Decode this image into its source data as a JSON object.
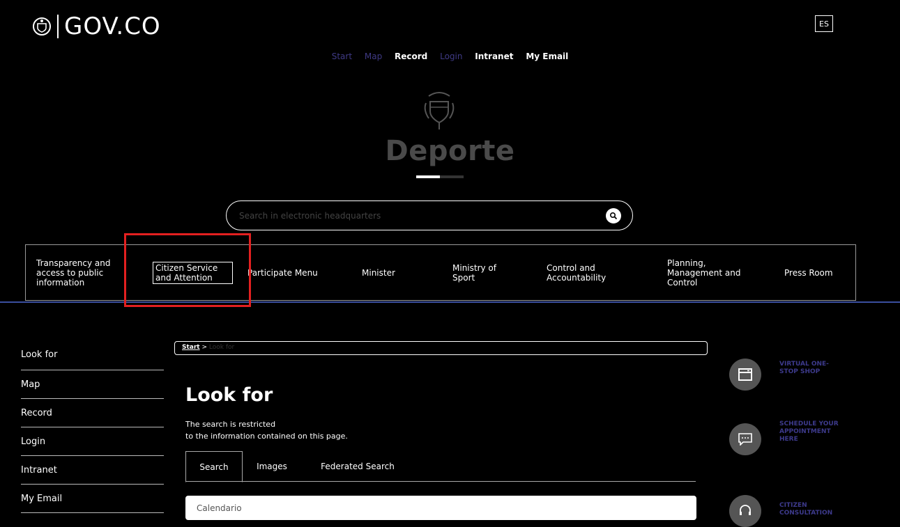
{
  "header": {
    "gov_logo_text": "GOV.CO",
    "lang_button": "ES"
  },
  "top_nav": [
    {
      "label": "Start",
      "dim": true
    },
    {
      "label": "Map",
      "dim": true
    },
    {
      "label": "Record",
      "dim": false
    },
    {
      "label": "Login",
      "dim": true
    },
    {
      "label": "Intranet",
      "dim": false
    },
    {
      "label": "My Email",
      "dim": false
    }
  ],
  "brand": {
    "name": "Deporte"
  },
  "search": {
    "placeholder": "Search in electronic headquarters"
  },
  "main_nav": [
    "Transparency and access to public information",
    "Citizen Service and Attention",
    "Participate Menu",
    "Minister",
    "Ministry of Sport",
    "Control and Accountability",
    "Planning, Management and Control",
    "Press Room"
  ],
  "sidebar": {
    "items": [
      "Look for",
      "Map",
      "Record",
      "Login",
      "Intranet",
      "My Email"
    ]
  },
  "breadcrumb": {
    "start": "Start",
    "separator": ">",
    "current": "Look for"
  },
  "content": {
    "title": "Look for",
    "desc_line1": "The search is restricted",
    "desc_line2": "to the information contained on this page.",
    "tabs": [
      "Search",
      "Images",
      "Federated Search"
    ],
    "search_value": "Calendario"
  },
  "quick_links": [
    {
      "label": "VIRTUAL ONE-STOP SHOP",
      "icon": "window-icon"
    },
    {
      "label": "SCHEDULE YOUR APPOINTMENT HERE",
      "icon": "chat-icon"
    },
    {
      "label": "CITIZEN CONSULTATION",
      "icon": "headset-icon"
    }
  ],
  "colors": {
    "accent_blue": "#3b4fa0",
    "highlight_red": "#e32020",
    "quick_link_text": "#3d3a8c"
  }
}
